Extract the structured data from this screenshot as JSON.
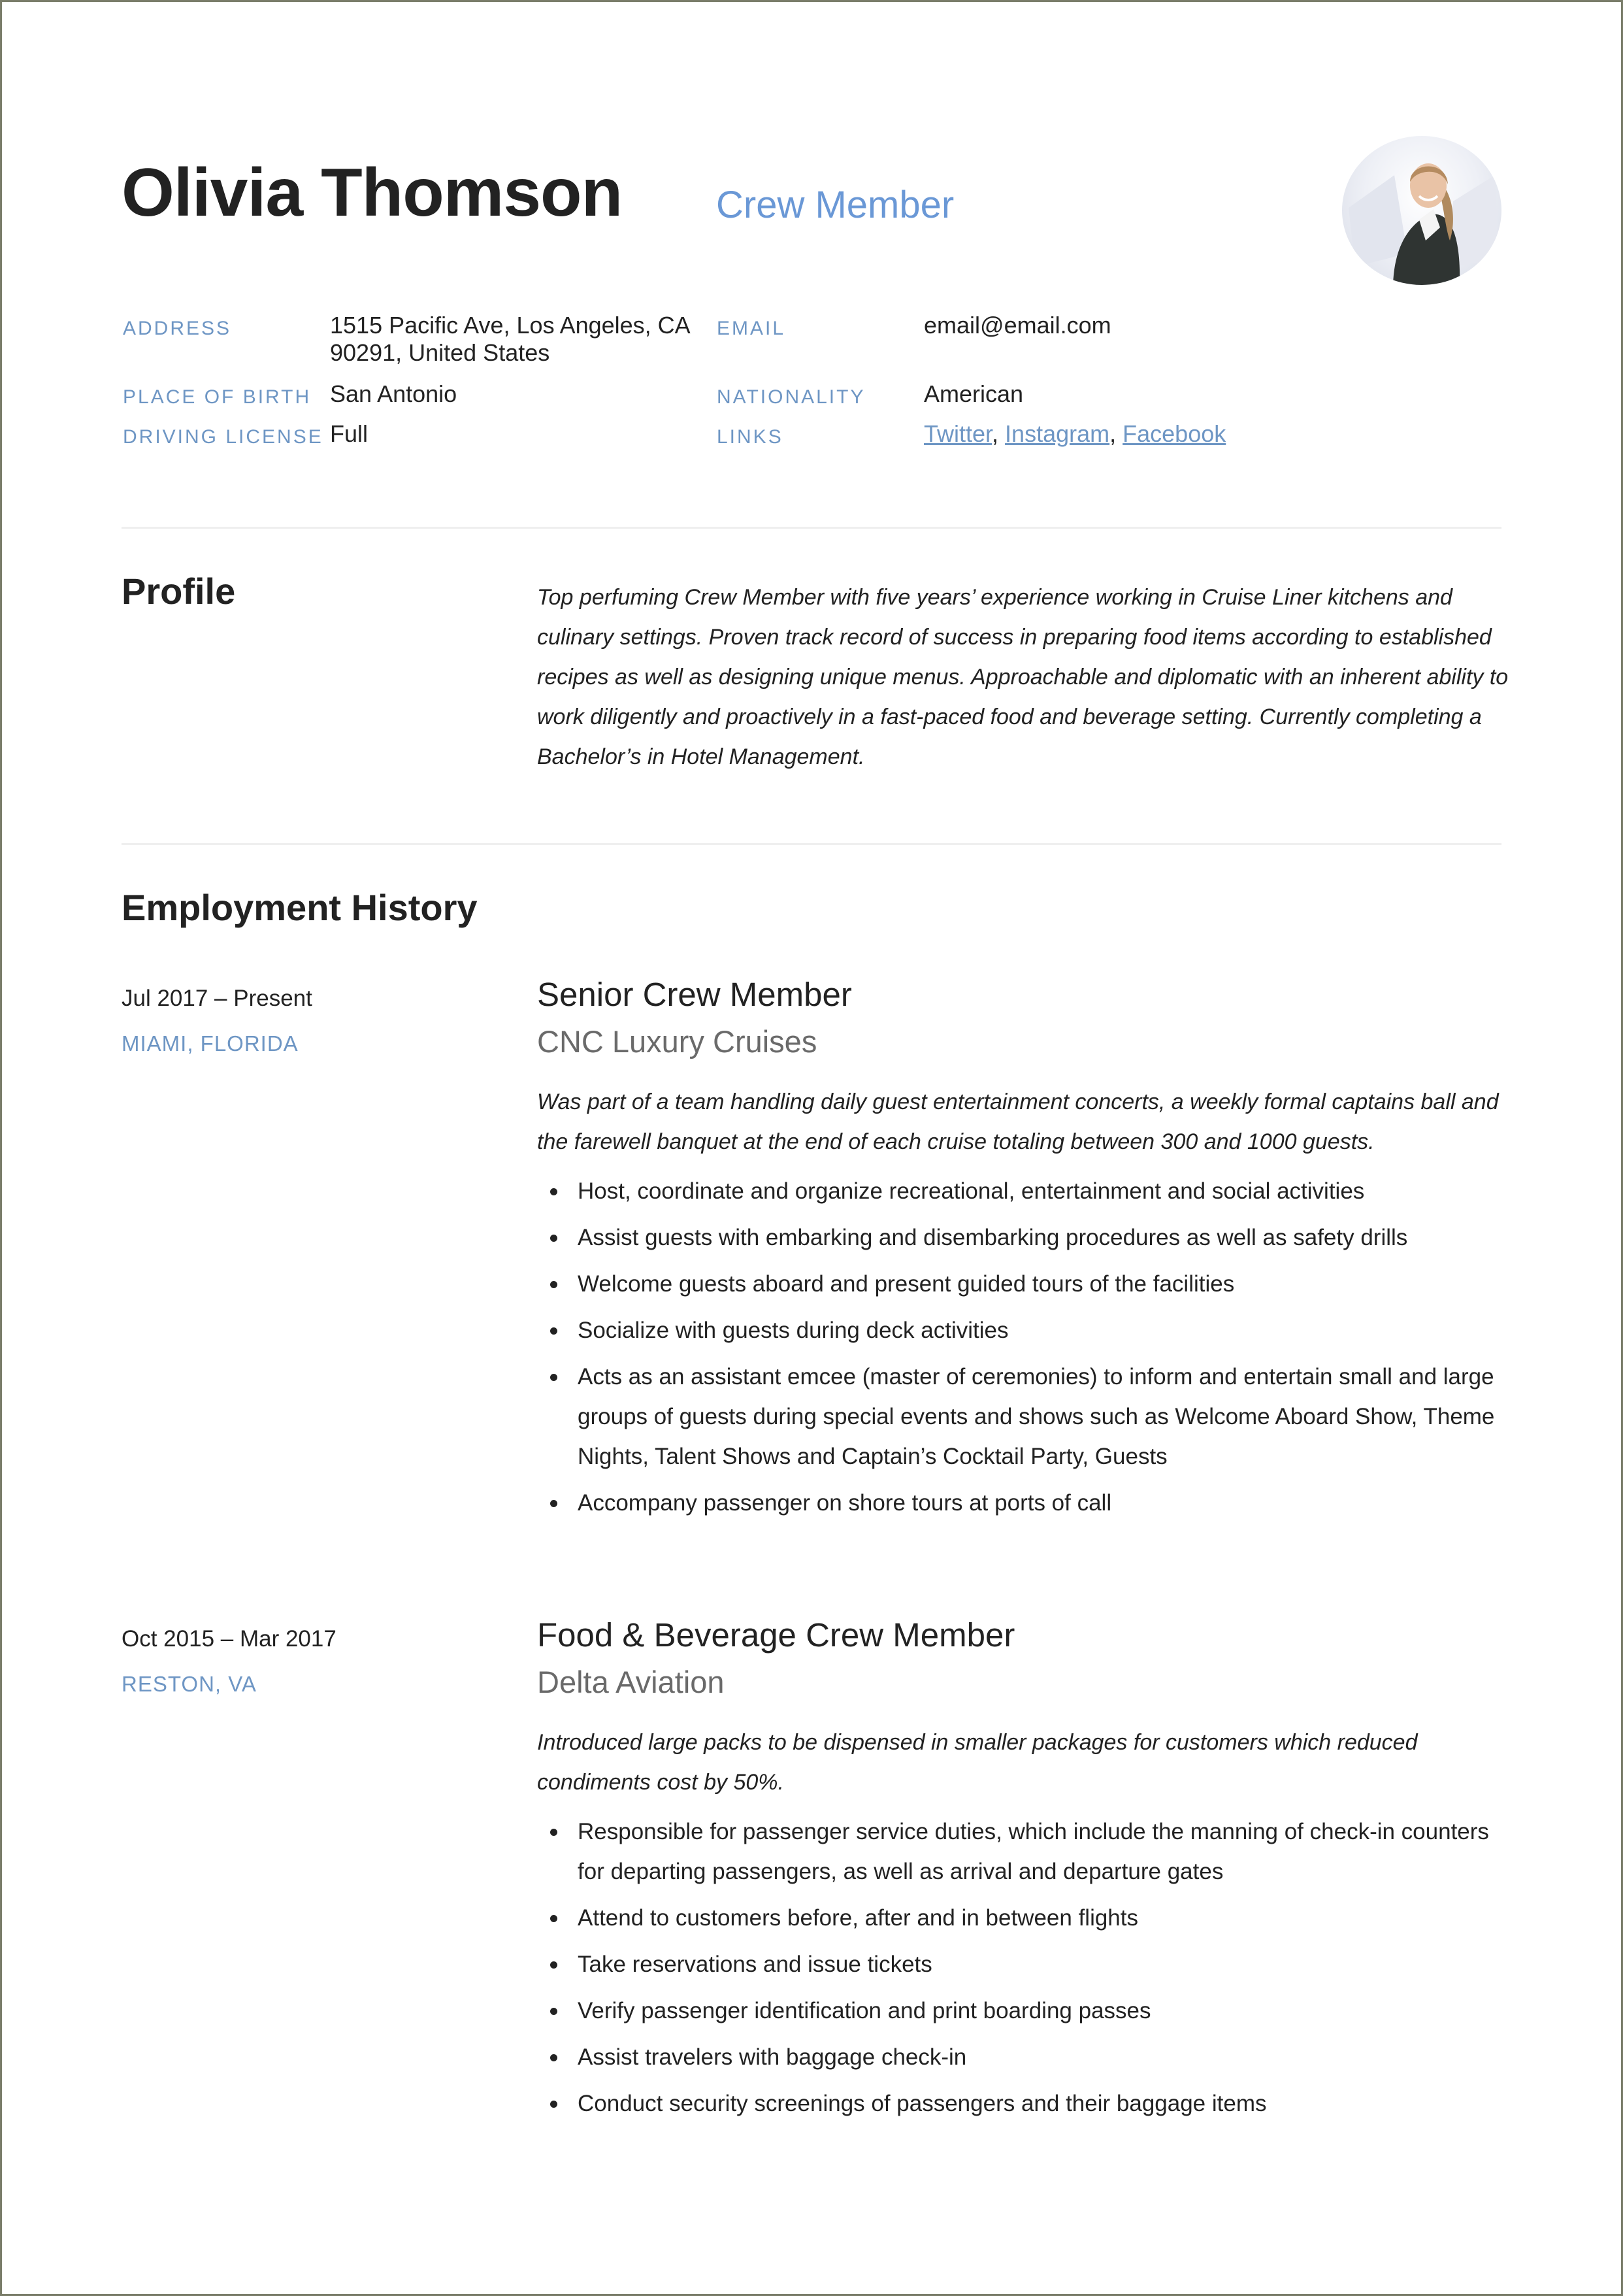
{
  "header": {
    "name": "Olivia Thomson",
    "job_title": "Crew Member",
    "avatar_alt": "Profile photo"
  },
  "details": {
    "address_label": "ADDRESS",
    "address_line1": "1515 Pacific Ave, Los Angeles, CA",
    "address_line2": "90291, United States",
    "birth_label": "PLACE OF BIRTH",
    "birth_value": "San Antonio",
    "license_label": "DRIVING LICENSE",
    "license_value": "Full",
    "email_label": "EMAIL",
    "email_value": "email@email.com",
    "nationality_label": "NATIONALITY",
    "nationality_value": "American",
    "links_label": "LINKS",
    "links": [
      "Twitter",
      "Instagram",
      "Facebook"
    ],
    "link_separator": ", "
  },
  "profile": {
    "heading": "Profile",
    "text": "Top perfuming Crew Member with five years’ experience working in Cruise Liner kitchens and culinary settings. Proven track record of success in preparing food items according to established recipes as well as designing unique menus. Approachable and diplomatic with an inherent ability to work diligently and proactively in a fast-paced food and beverage setting. Currently completing a Bachelor’s in Hotel Management."
  },
  "employment": {
    "heading": "Employment History",
    "jobs": [
      {
        "dates": "Jul 2017 – Present",
        "location": "MIAMI, FLORIDA",
        "title": "Senior Crew Member",
        "company": "CNC Luxury Cruises",
        "summary": "Was part of a team handling daily guest entertainment concerts, a weekly formal captains ball and the farewell banquet at the end of each cruise totaling between 300 and 1000 guests.",
        "bullets": [
          "Host, coordinate and organize recreational, entertainment and social activities",
          "Assist guests with embarking and disembarking procedures as well as safety drills",
          "Welcome guests aboard and present guided tours of the facilities",
          "Socialize with guests during deck activities",
          "Acts as an assistant emcee (master of ceremonies) to inform and entertain small and large groups of guests during special events and shows such as Welcome Aboard Show, Theme Nights, Talent Shows and Captain’s Cocktail Party, Guests",
          "Accompany passenger on shore tours at ports of call"
        ]
      },
      {
        "dates": "Oct 2015 – Mar 2017",
        "location": "RESTON, VA",
        "title": "Food & Beverage Crew Member",
        "company": "Delta Aviation",
        "summary": "Introduced large packs to be dispensed in smaller packages for customers which reduced condiments cost by 50%.",
        "bullets": [
          "Responsible for passenger service duties, which include the manning of check-in counters for departing passengers, as well as arrival and departure gates",
          "Attend to customers before, after and in between flights",
          "Take reservations and issue tickets",
          "Verify passenger identification and print boarding passes",
          "Assist travelers with baggage check-in",
          "Conduct security screenings of passengers and their baggage items"
        ]
      }
    ]
  },
  "colors": {
    "accent": "#6a98d6",
    "label": "#6e96c4",
    "text": "#222222",
    "muted": "#6a6a6a",
    "divider": "#efefef",
    "frame": "#7a7d6a"
  }
}
